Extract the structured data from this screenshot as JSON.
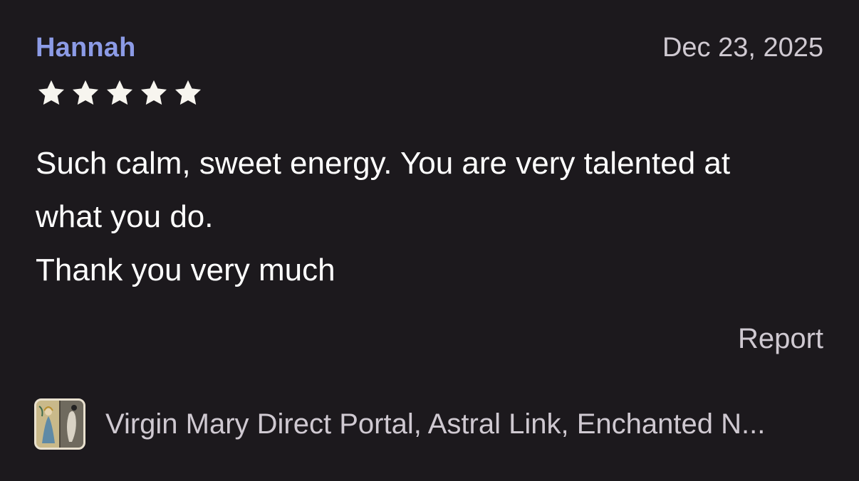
{
  "review": {
    "reviewer_name": "Hannah",
    "date": "Dec 23, 2025",
    "rating": 5,
    "rating_max": 5,
    "body_lines": [
      "Such calm, sweet energy. You are very talented at",
      "what you do.",
      "Thank you very much"
    ],
    "report_label": "Report"
  },
  "product": {
    "thumbnail_icon": "virgin-mary-card-thumbnail",
    "title": "Virgin Mary Direct Portal, Astral Link, Enchanted N..."
  },
  "colors": {
    "background": "#1c191d",
    "reviewer_name": "#8c9be6",
    "muted_text": "#cfc9d1",
    "star": "#f7f5ef"
  }
}
